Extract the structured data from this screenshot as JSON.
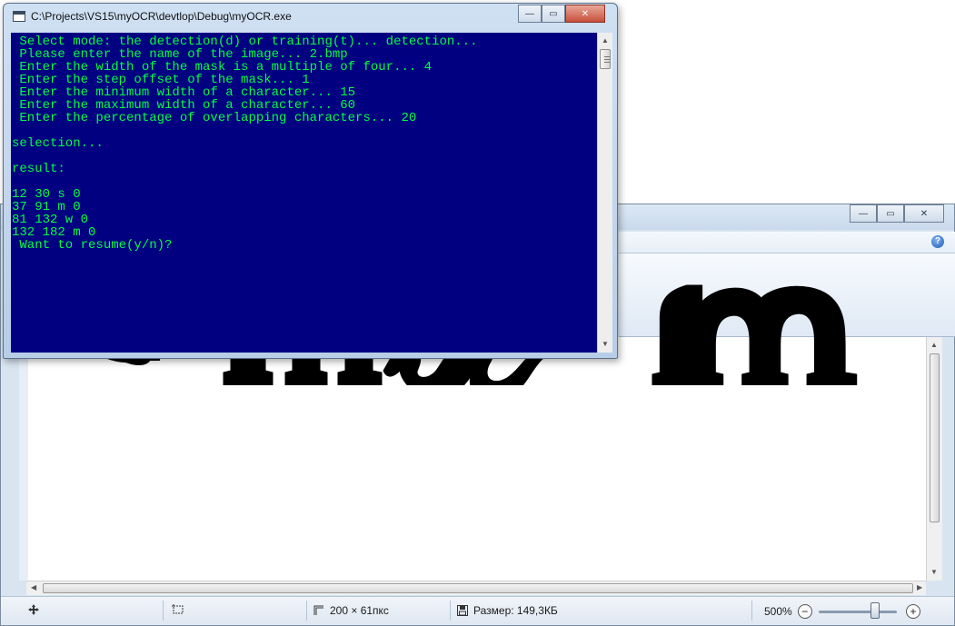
{
  "console": {
    "title": "C:\\Projects\\VS15\\myOCR\\devtlop\\Debug\\myOCR.exe",
    "lines": [
      " Select mode: the detection(d) or training(t)... detection...",
      " Please enter the name of the image... 2.bmp",
      " Enter the width of the mask is a multiple of four... 4",
      " Enter the step offset of the mask... 1",
      " Enter the minimum width of a character... 15",
      " Enter the maximum width of a character... 60",
      " Enter the percentage of overlapping characters... 20",
      "",
      "selection...",
      "",
      "result:",
      "",
      "12 30 s 0",
      "37 91 m 0",
      "81 132 w 0",
      "132 182 m 0",
      " Want to resume(y/n)?"
    ],
    "colors": {
      "background": "#000080",
      "text": "#00ff40"
    }
  },
  "paint": {
    "canvas_image_text": "smwm",
    "status": {
      "dimensions": "200 × 61пкс",
      "size": "Размер: 149,3КБ",
      "zoom": "500%"
    },
    "zoom_level": 0.72,
    "icons": [
      "move-icon",
      "select-icon",
      "resize-icon",
      "save-icon",
      "zoom-out-icon",
      "zoom-in-icon",
      "help-icon"
    ]
  }
}
